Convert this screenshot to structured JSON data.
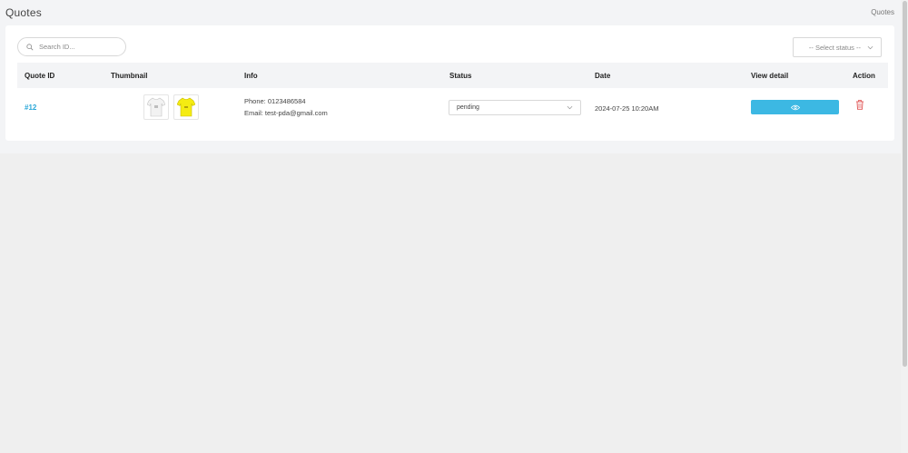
{
  "page": {
    "title": "Quotes",
    "breadcrumb": "Quotes"
  },
  "search": {
    "placeholder": "Search ID..."
  },
  "status_filter": {
    "label": "-- Select status --"
  },
  "table": {
    "headers": {
      "quote_id": "Quote ID",
      "thumbnail": "Thumbnail",
      "info": "Info",
      "status": "Status",
      "date": "Date",
      "view_detail": "View detail",
      "action": "Action"
    },
    "rows": [
      {
        "quote_id": "#12",
        "thumbnails": [
          "white-tshirt",
          "yellow-tshirt"
        ],
        "phone": "Phone: 0123486584",
        "email": "Email: test-pda@gmail.com",
        "status": "pending",
        "date": "2024-07-25 10:20AM",
        "view_icon": "eye-icon",
        "action_icon": "trash-icon"
      }
    ]
  },
  "colors": {
    "accent": "#2aa7d8",
    "view_button": "#3cb8e3",
    "delete": "#e05252",
    "header_bg": "#f3f4f6",
    "shirt_white": "#f2f2f2",
    "shirt_yellow": "#f5ec12"
  }
}
